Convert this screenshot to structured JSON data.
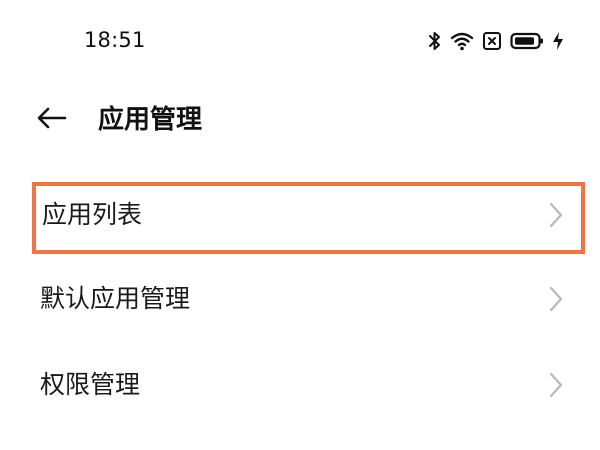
{
  "status_bar": {
    "time": "18:51",
    "icons": [
      "bluetooth-icon",
      "wifi-icon",
      "sim-blocked-icon",
      "battery-icon",
      "charging-icon"
    ]
  },
  "header": {
    "back_icon": "back-arrow-icon",
    "title": "应用管理"
  },
  "menu": {
    "items": [
      {
        "label": "应用列表",
        "highlighted": true
      },
      {
        "label": "默认应用管理",
        "highlighted": false
      },
      {
        "label": "权限管理",
        "highlighted": false
      }
    ]
  },
  "colors": {
    "highlight": "#f07544",
    "chevron": "#b8b8b8",
    "text": "#1a1a1a"
  }
}
